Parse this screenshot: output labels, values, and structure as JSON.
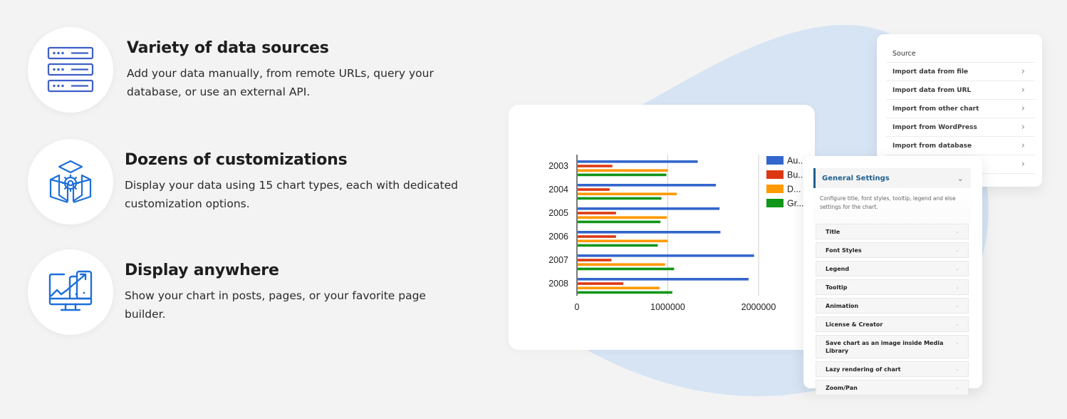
{
  "features": [
    {
      "icon": "server-stack-icon",
      "title": "Variety of data sources",
      "description": "Add your data manually, from remote URLs, query your database, or use an external API."
    },
    {
      "icon": "box-gear-icon",
      "title": "Dozens of customizations",
      "description": "Display your data using 15 chart types, each with dedicated customization options."
    },
    {
      "icon": "devices-chart-icon",
      "title": "Display anywhere",
      "description": "Show your chart in posts, pages, or your favorite page builder."
    }
  ],
  "colors": {
    "accent_blue": "#1e6fd9",
    "icon_blue": "#3f5fc8",
    "blob": "#d6e4f4",
    "settings_title": "#1f5f8f"
  },
  "source_panel": {
    "title": "Source",
    "items": [
      {
        "label": "Import data from file",
        "icon": "chevron-right-icon"
      },
      {
        "label": "Import data from URL",
        "icon": "chevron-right-icon"
      },
      {
        "label": "Import from other chart",
        "icon": "chevron-right-icon"
      },
      {
        "label": "Import from WordPress",
        "icon": "chevron-right-icon"
      },
      {
        "label": "Import from database",
        "icon": "chevron-right-icon"
      },
      {
        "label": "",
        "icon": "chevron-right-icon"
      }
    ]
  },
  "settings_panel": {
    "title": "General Settings",
    "description": "Configure title, font styles, tooltip, legend and else settings for the chart.",
    "items": [
      "Title",
      "Font Styles",
      "Legend",
      "Tooltip",
      "Animation",
      "License & Creator",
      "Save chart as an image inside Media Library",
      "Lazy rendering of chart",
      "Zoom/Pan"
    ]
  },
  "chart_data": {
    "type": "bar",
    "orientation": "horizontal",
    "title": "",
    "xlabel": "",
    "ylabel": "",
    "categories": [
      "2003",
      "2004",
      "2005",
      "2006",
      "2007",
      "2008"
    ],
    "series": [
      {
        "name": "Au...",
        "color": "#3366cc",
        "values": [
          1330000,
          1530000,
          1570000,
          1580000,
          1950000,
          1890000
        ]
      },
      {
        "name": "Bu...",
        "color": "#dc3912",
        "values": [
          390000,
          360000,
          430000,
          430000,
          380000,
          510000
        ]
      },
      {
        "name": "D...",
        "color": "#ff9900",
        "values": [
          1000000,
          1100000,
          990000,
          1000000,
          970000,
          910000
        ]
      },
      {
        "name": "Gr...",
        "color": "#109618",
        "values": [
          985000,
          930000,
          920000,
          890000,
          1070000,
          1050000
        ]
      }
    ],
    "xlim": [
      0,
      2000000
    ],
    "x_ticks": [
      "0",
      "1000000",
      "2000000"
    ],
    "grid": true,
    "legend_position": "right"
  }
}
